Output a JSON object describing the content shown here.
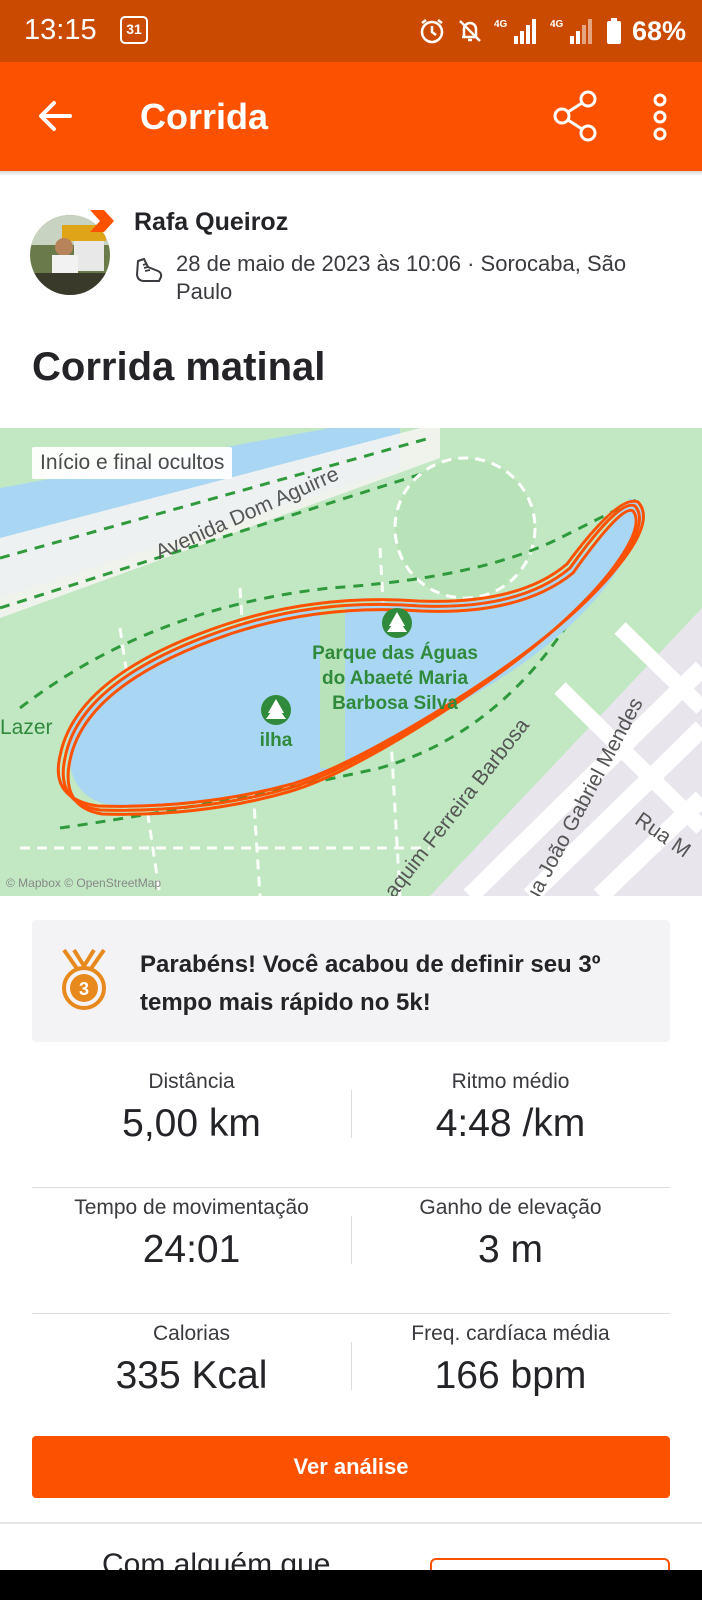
{
  "status_bar": {
    "time": "13:15",
    "calendar_day": "31",
    "battery": "68%"
  },
  "app_bar": {
    "title": "Corrida",
    "icons": [
      "back-arrow-icon",
      "share-icon",
      "more-vertical-icon"
    ]
  },
  "athlete": {
    "name": "Rafa Queiroz",
    "meta": "28 de maio de 2023 às 10:06 · Sorocaba, São Paulo"
  },
  "activity": {
    "title": "Corrida matinal"
  },
  "map": {
    "chip": "Início e final ocultos",
    "park_label": "Parque das Águas do Abaeté Maria Barbosa Silva",
    "island_label": "ilha",
    "left_label": "Lazer",
    "streets": [
      "Avenida Dom Aguirre",
      "aquim Ferreira Barbosa",
      "ua João Gabriel Mendes",
      "Rua M"
    ],
    "attribution": "© Mapbox © OpenStreetMap",
    "route_color": "#fc5200"
  },
  "achievement": {
    "text": "Parabéns! Você acabou de definir seu 3º tempo mais rápido no 5k!",
    "medal_rank": "3",
    "medal_color": "#e8891d"
  },
  "stats": [
    [
      {
        "label": "Distância",
        "value": "5,00 km"
      },
      {
        "label": "Ritmo médio",
        "value": "4:48 /km"
      }
    ],
    [
      {
        "label": "Tempo de movimentação",
        "value": "24:01"
      },
      {
        "label": "Ganho de elevação",
        "value": "3 m"
      }
    ],
    [
      {
        "label": "Calorias",
        "value": "335 Kcal"
      },
      {
        "label": "Freq. cardíaca média",
        "value": "166 bpm"
      }
    ]
  ],
  "cta": {
    "label": "Ver análise"
  },
  "bottom": {
    "peek_text": "Com alguém que"
  },
  "colors": {
    "brand": "#fc5200",
    "status_bar": "#c94a00"
  }
}
